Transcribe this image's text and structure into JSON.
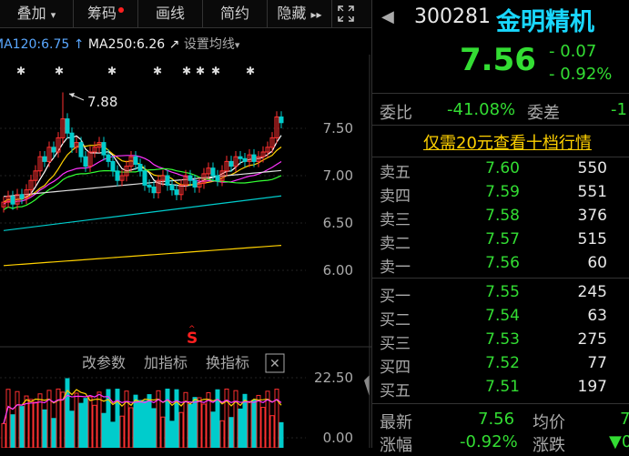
{
  "toolbar": {
    "overlay": "叠加",
    "overlay_arrow": "▾",
    "chips": "筹码",
    "drawline": "画线",
    "brief": "简约",
    "hide": "隐藏",
    "hide_arrow": "▸▸",
    "fullscreen_icon": "expand-icon"
  },
  "ma_legend": {
    "ma120": "MA120:6.75",
    "ma120_arrow": "↑",
    "ma250": "MA250:6.26",
    "ma250_arrow": "↗",
    "set_ma": "设置均线",
    "set_ma_arrow": "▾"
  },
  "chart_labels": {
    "high_annotation": "7.88",
    "signal_mark": "S",
    "indicator_buttons": [
      "改参数",
      "加指标",
      "换指标"
    ],
    "close_icon": "✕"
  },
  "chart_data": [
    {
      "type": "candlestick",
      "y_ticks": [
        "7.50",
        "7.00",
        "6.50",
        "6.00"
      ],
      "annotation_high": 7.88
    },
    {
      "type": "bar",
      "y_ticks": [
        "22.50",
        "0.00"
      ]
    }
  ],
  "quote": {
    "back_arrow": "◀",
    "code": "300281",
    "name": "金明精机",
    "price": "7.56",
    "change": "- 0.07",
    "change_pct": "- 0.92%",
    "weibi_label": "委比",
    "weibi_value": "-41.08%",
    "weicha_label": "委差",
    "weicha_value": "-1",
    "promo": "仅需20元查看十档行情"
  },
  "asks": [
    {
      "label": "卖五",
      "price": "7.60",
      "vol": "550"
    },
    {
      "label": "卖四",
      "price": "7.59",
      "vol": "551"
    },
    {
      "label": "卖三",
      "price": "7.58",
      "vol": "376"
    },
    {
      "label": "卖二",
      "price": "7.57",
      "vol": "515"
    },
    {
      "label": "卖一",
      "price": "7.56",
      "vol": "60"
    }
  ],
  "bids": [
    {
      "label": "买一",
      "price": "7.55",
      "vol": "245"
    },
    {
      "label": "买二",
      "price": "7.54",
      "vol": "63"
    },
    {
      "label": "买三",
      "price": "7.53",
      "vol": "275"
    },
    {
      "label": "买四",
      "price": "7.52",
      "vol": "77"
    },
    {
      "label": "买五",
      "price": "7.51",
      "vol": "197"
    }
  ],
  "stats": {
    "latest_label": "最新",
    "latest_value": "7.56",
    "avg_label": "均价",
    "avg_value": "7",
    "chg_label": "涨幅",
    "chg_value": "-0.92%",
    "drop_label": "涨跌",
    "drop_value": "▼0"
  },
  "colors": {
    "up": "#ff3030",
    "down": "#00cccc",
    "green_text": "#33dd33",
    "name_cyan": "#19d7ff",
    "ma5": "#ffffff",
    "ma10": "#ffd100",
    "ma20": "#ff33ff",
    "ma60": "#33ff33"
  }
}
